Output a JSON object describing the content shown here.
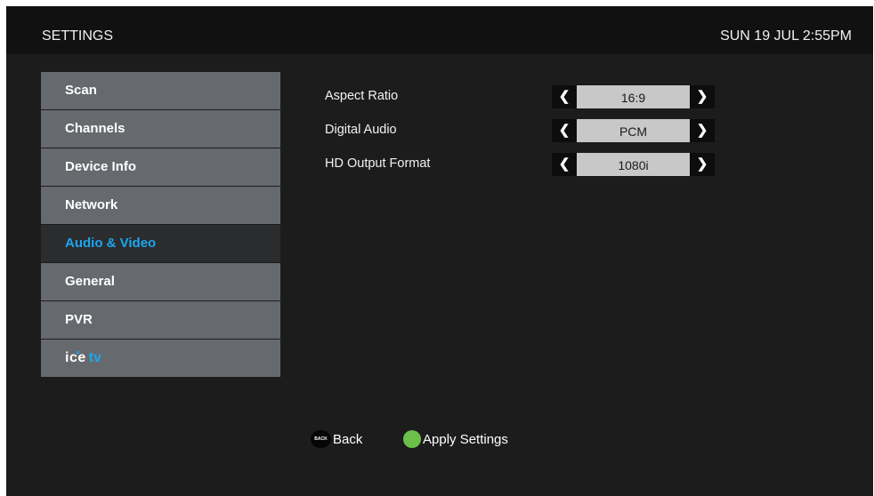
{
  "header": {
    "title": "SETTINGS",
    "clock": "SUN 19 JUL 2:55PM"
  },
  "menu": {
    "items": [
      {
        "label": "Scan"
      },
      {
        "label": "Channels"
      },
      {
        "label": "Device Info"
      },
      {
        "label": "Network"
      },
      {
        "label": "Audio & Video",
        "active": true
      },
      {
        "label": "General"
      },
      {
        "label": "PVR"
      }
    ],
    "logo": {
      "ice": "ice",
      "tv": "tv"
    }
  },
  "settings": [
    {
      "label": "Aspect Ratio",
      "value": "16:9"
    },
    {
      "label": "Digital Audio",
      "value": "PCM"
    },
    {
      "label": "HD Output Format",
      "value": "1080i"
    }
  ],
  "footer": {
    "back_icon_text": "BACK",
    "back_label": "Back",
    "apply_label": "Apply Settings"
  },
  "colors": {
    "accent": "#1aa7ee",
    "apply_button": "#6cc04a",
    "menu_item": "#66696d",
    "menu_active_bg": "#2b2c2e"
  },
  "icons": {
    "arrow_left": "chevron-left-icon",
    "arrow_right": "chevron-right-icon",
    "back": "back-button-icon",
    "apply": "green-button-icon"
  }
}
